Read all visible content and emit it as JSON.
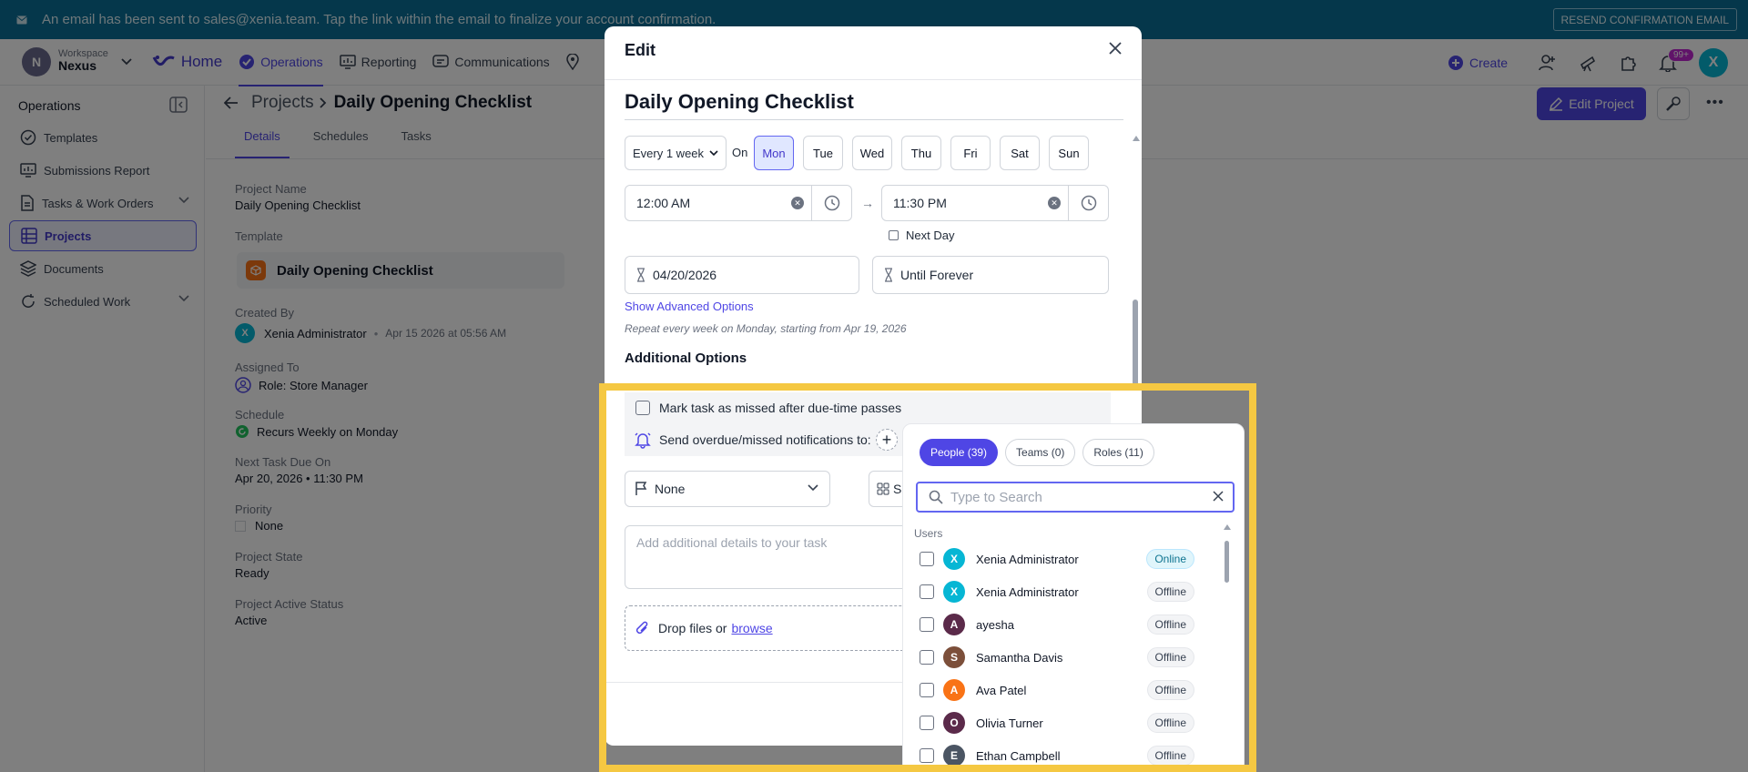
{
  "banner": {
    "message": "An email has been sent to sales@xenia.team. Tap the link within the email to finalize your account confirmation.",
    "resend_label": "RESEND CONFIRMATION EMAIL"
  },
  "topnav": {
    "workspace_label": "Workspace",
    "workspace_name": "Nexus",
    "workspace_initial": "N",
    "home_label": "Home",
    "items": [
      {
        "label": "Operations",
        "icon": "check-circle-icon",
        "active": true
      },
      {
        "label": "Reporting",
        "icon": "monitor-chart-icon"
      },
      {
        "label": "Communications",
        "icon": "chat-icon"
      }
    ],
    "create_label": "Create",
    "notif_badge": "99+",
    "user_initial": "X"
  },
  "sidebar": {
    "header": "Operations",
    "items": [
      {
        "label": "Templates",
        "icon": "check-circle-icon"
      },
      {
        "label": "Submissions Report",
        "icon": "monitor-icon"
      },
      {
        "label": "Tasks & Work Orders",
        "icon": "document-icon",
        "expandable": true
      },
      {
        "label": "Projects",
        "icon": "projects-icon",
        "active": true
      },
      {
        "label": "Documents",
        "icon": "layers-icon"
      },
      {
        "label": "Scheduled Work",
        "icon": "refresh-icon",
        "expandable": true
      }
    ]
  },
  "main": {
    "breadcrumb_parent": "Projects",
    "breadcrumb_current": "Daily Opening Checklist",
    "tabs": [
      "Details",
      "Schedules",
      "Tasks"
    ],
    "edit_project_label": "Edit Project",
    "fields": {
      "project_name_label": "Project Name",
      "project_name": "Daily Opening Checklist",
      "template_label": "Template",
      "template": "Daily Opening Checklist",
      "created_by_label": "Created By",
      "created_by": "Xenia Administrator",
      "created_at": "Apr 15 2026 at 05:56 AM",
      "assigned_to_label": "Assigned To",
      "assigned_to": "Role: Store Manager",
      "schedule_label": "Schedule",
      "schedule": "Recurs Weekly on Monday",
      "next_due_label": "Next Task Due On",
      "next_due": "Apr 20, 2026 • 11:30 PM",
      "priority_label": "Priority",
      "priority": "None",
      "state_label": "Project State",
      "state": "Ready",
      "active_label": "Project Active Status",
      "active": "Active"
    }
  },
  "modal": {
    "title": "Edit",
    "project_name": "Daily Opening Checklist",
    "frequency": "Every 1 week",
    "on_label": "On",
    "days": [
      "Mon",
      "Tue",
      "Wed",
      "Thu",
      "Fri",
      "Sat",
      "Sun"
    ],
    "selected_day": "Mon",
    "start_time": "12:00 AM",
    "end_time": "11:30 PM",
    "next_day_label": "Next Day",
    "start_date": "04/20/2026",
    "end_date": "Until Forever",
    "advanced_label": "Show Advanced Options",
    "repeat_text": "Repeat every week on Monday, starting from Apr 19, 2026",
    "additional_options": "Additional Options",
    "missed_label": "Mark task as missed after due-time passes",
    "notify_label": "Send overdue/missed notifications to:",
    "priority_value": "None",
    "category_partial": "S",
    "description_placeholder": "Add additional details to your task",
    "drop_text": "Drop files or",
    "browse_label": "browse"
  },
  "popup": {
    "tabs": [
      {
        "label": "People (39)",
        "active": true
      },
      {
        "label": "Teams (0)"
      },
      {
        "label": "Roles (11)"
      }
    ],
    "search_placeholder": "Type to Search",
    "section_label": "Users",
    "users": [
      {
        "initial": "X",
        "name": "Xenia Administrator",
        "status": "Online",
        "color": "#06b6d4"
      },
      {
        "initial": "X",
        "name": "Xenia Administrator",
        "status": "Offline",
        "color": "#06b6d4"
      },
      {
        "initial": "A",
        "name": "ayesha",
        "status": "Offline",
        "color": "#5b2a4a"
      },
      {
        "initial": "S",
        "name": "Samantha Davis",
        "status": "Offline",
        "color": "#7c4f3a"
      },
      {
        "initial": "A",
        "name": "Ava Patel",
        "status": "Offline",
        "color": "#f97316"
      },
      {
        "initial": "O",
        "name": "Olivia Turner",
        "status": "Offline",
        "color": "#5b2a4a"
      },
      {
        "initial": "E",
        "name": "Ethan Campbell",
        "status": "Offline",
        "color": "#4b5563"
      }
    ]
  },
  "colors": {
    "banner": "#0b6f96",
    "accent": "#4f46e5",
    "highlight": "#f5c842"
  }
}
